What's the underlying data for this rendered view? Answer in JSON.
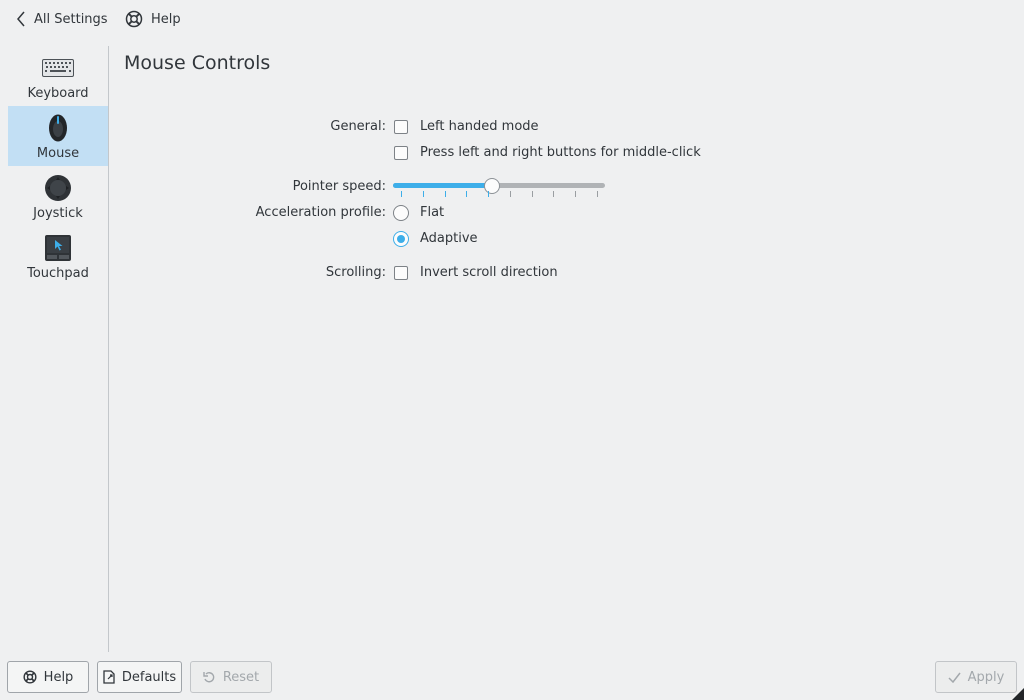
{
  "toolbar": {
    "back_label": "All Settings",
    "help_label": "Help"
  },
  "sidebar": {
    "items": [
      {
        "label": "Keyboard",
        "icon": "keyboard-icon"
      },
      {
        "label": "Mouse",
        "icon": "mouse-icon",
        "selected": true
      },
      {
        "label": "Joystick",
        "icon": "joystick-icon"
      },
      {
        "label": "Touchpad",
        "icon": "touchpad-icon"
      }
    ]
  },
  "main": {
    "title": "Mouse Controls",
    "general": {
      "label": "General:",
      "left_handed": {
        "label": "Left handed mode",
        "checked": false
      },
      "middle_click": {
        "label": "Press left and right buttons for middle-click",
        "checked": false
      }
    },
    "pointer_speed": {
      "label": "Pointer speed:",
      "value": 5,
      "min": 1,
      "max": 10
    },
    "acceleration": {
      "label": "Acceleration profile:",
      "options": [
        {
          "label": "Flat",
          "selected": false
        },
        {
          "label": "Adaptive",
          "selected": true
        }
      ]
    },
    "scrolling": {
      "label": "Scrolling:",
      "invert": {
        "label": "Invert scroll direction",
        "checked": false
      }
    }
  },
  "buttons": {
    "help": "Help",
    "defaults": "Defaults",
    "reset": "Reset",
    "apply": "Apply"
  },
  "colors": {
    "accent": "#3daee9",
    "selection": "#c2dff4",
    "background": "#eff0f1",
    "text": "#31363b"
  }
}
